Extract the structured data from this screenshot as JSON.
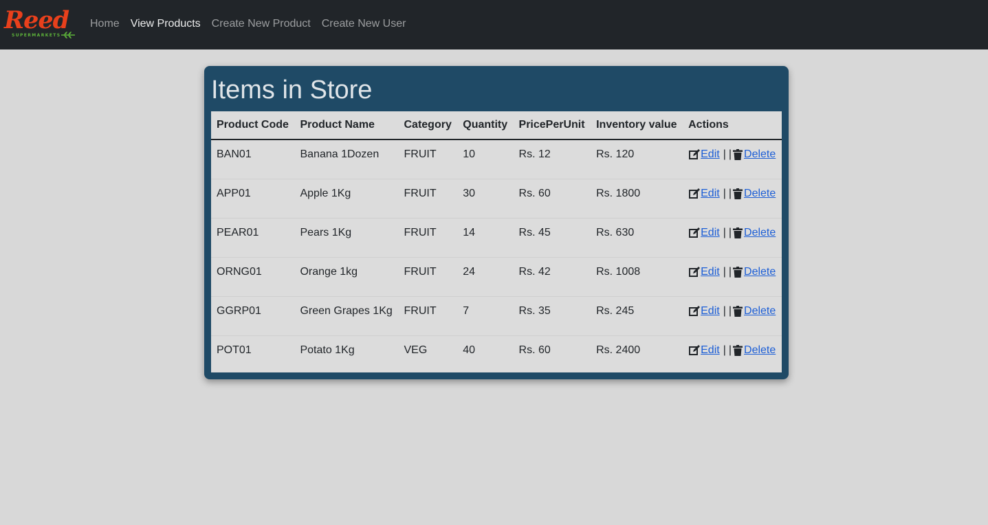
{
  "brand": {
    "name": "Reed",
    "tagline": "SUPERMARKETS",
    "color": "#e8401c",
    "accent": "#5db33a"
  },
  "nav": {
    "items": [
      {
        "label": "Home",
        "active": false
      },
      {
        "label": "View Products",
        "active": true
      },
      {
        "label": "Create New Product",
        "active": false
      },
      {
        "label": "Create New User",
        "active": false
      }
    ]
  },
  "main": {
    "title": "Items in Store",
    "table": {
      "headers": [
        "Product Code",
        "Product Name",
        "Category",
        "Quantity",
        "PricePerUnit",
        "Inventory value",
        "Actions"
      ],
      "rows": [
        [
          "BAN01",
          "Banana 1Dozen",
          "FRUIT",
          "10",
          "Rs. 12",
          "Rs. 120"
        ],
        [
          "APP01",
          "Apple 1Kg",
          "FRUIT",
          "30",
          "Rs. 60",
          "Rs. 1800"
        ],
        [
          "PEAR01",
          "Pears 1Kg",
          "FRUIT",
          "14",
          "Rs. 45",
          "Rs. 630"
        ],
        [
          "ORNG01",
          "Orange 1kg",
          "FRUIT",
          "24",
          "Rs. 42",
          "Rs. 1008"
        ],
        [
          "GGRP01",
          "Green Grapes 1Kg",
          "FRUIT",
          "7",
          "Rs. 35",
          "Rs. 245"
        ],
        [
          "POT01",
          "Potato 1Kg",
          "VEG",
          "40",
          "Rs. 60",
          "Rs. 2400"
        ]
      ],
      "edit_label": "Edit",
      "delete_label": "Delete",
      "separator": "|",
      "edit_icon": "edit-icon",
      "delete_icon": "trash-icon"
    }
  },
  "colors": {
    "navbar": "#212529",
    "card": "#1f4a66",
    "link": "#1c5ed6",
    "background": "#d8d8d8"
  }
}
